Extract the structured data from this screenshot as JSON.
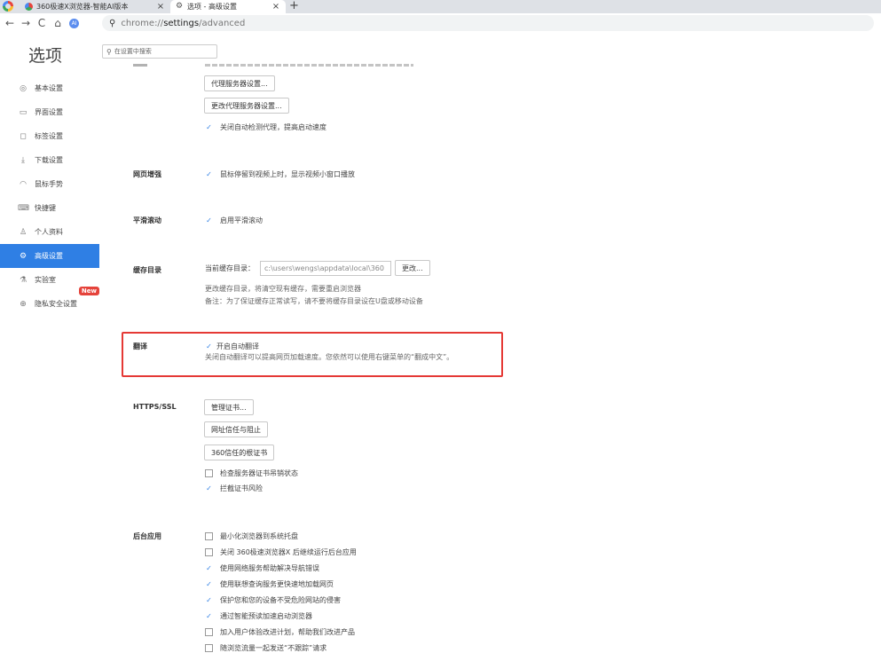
{
  "tabs": [
    {
      "title": "360极速X浏览器-智能AI版本",
      "close": "×"
    },
    {
      "title": "选项 - 高级设置",
      "close": "×"
    }
  ],
  "new_tab_symbol": "+",
  "toolbar": {
    "back": "←",
    "forward": "→",
    "reload": "C",
    "home": "⌂",
    "profile_initial": "AI",
    "url_scheme": "chrome://",
    "url_host": "settings",
    "url_path": "/advanced"
  },
  "settings": {
    "title": "选项",
    "search_placeholder": "在设置中搜索"
  },
  "sidebar": {
    "items": [
      {
        "icon": "◎",
        "label": "基本设置"
      },
      {
        "icon": "▭",
        "label": "界面设置"
      },
      {
        "icon": "◻",
        "label": "标签设置"
      },
      {
        "icon": "⤓",
        "label": "下载设置"
      },
      {
        "icon": "◠",
        "label": "鼠标手势"
      },
      {
        "icon": "⌨",
        "label": "快捷键"
      },
      {
        "icon": "♙",
        "label": "个人资料"
      },
      {
        "icon": "⚙",
        "label": "高级设置"
      },
      {
        "icon": "⚗",
        "label": "实验室"
      },
      {
        "icon": "⊕",
        "label": "隐私安全设置"
      }
    ],
    "new_badge": "New"
  },
  "proxy": {
    "proxy_button": "代理服务器设置...",
    "change_proxy_button": "更改代理服务器设置...",
    "auto_detect": "关闭自动检测代理，提高启动速度"
  },
  "web_enhance": {
    "label": "网页增强",
    "video_popup": "鼠标停留到视频上时，显示视频小窗口播放"
  },
  "smooth_scroll": {
    "label": "平滑滚动",
    "enable": "启用平滑滚动"
  },
  "cache": {
    "label": "缓存目录",
    "current_label": "当前缓存目录：",
    "path": "c:\\users\\wengs\\appdata\\local\\360",
    "change_button": "更改...",
    "note1": "更改缓存目录，将清空现有缓存，需要重启浏览器",
    "note2": "备注：为了保证缓存正常读写，请不要将缓存目录设在U盘或移动设备"
  },
  "translate": {
    "label": "翻译",
    "enable": "开启自动翻译",
    "note": "关闭自动翻译可以提高网页加载速度。您依然可以使用右键菜单的“翻成中文”。"
  },
  "https": {
    "label": "HTTPS/SSL",
    "manage_cert": "管理证书...",
    "site_trust": "网址信任与阻止",
    "root_cert": "360信任的根证书",
    "check_revocation": "检查服务器证书吊销状态",
    "block_risk": "拦截证书风险"
  },
  "background": {
    "label": "后台应用",
    "items": [
      {
        "text": "最小化浏览器到系统托盘",
        "checked": false
      },
      {
        "text": "关闭 360极速浏览器X 后继续运行后台应用",
        "checked": false
      },
      {
        "text": "使用网络服务帮助解决导航错误",
        "checked": true
      },
      {
        "text": "使用联想查询服务更快速地加载网页",
        "checked": true
      },
      {
        "text": "保护您和您的设备不受危险网站的侵害",
        "checked": true
      },
      {
        "text": "通过智能预读加速启动浏览器",
        "checked": true
      },
      {
        "text": "加入用户体验改进计划，帮助我们改进产品",
        "checked": false
      },
      {
        "text": "随浏览流量一起发送“不跟踪”请求",
        "checked": false
      }
    ]
  },
  "check_mark": "✓",
  "colors": {
    "accent": "#2f7fe4",
    "highlight": "#e53935",
    "badge": "#e5433b"
  }
}
